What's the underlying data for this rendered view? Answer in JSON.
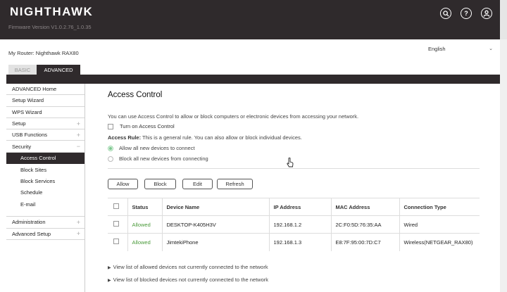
{
  "header": {
    "brand": "NIGHTHAWK",
    "firmware": "Firmware Version V1.0.2.76_1.0.35",
    "icons": [
      "search-icon",
      "help-icon",
      "user-icon"
    ]
  },
  "router": {
    "label": "My Router: Nighthawk RAX80"
  },
  "language": {
    "selected": "English"
  },
  "tabs": {
    "basic": "BASIC",
    "advanced": "ADVANCED"
  },
  "sidebar": {
    "items": [
      {
        "label": "ADVANCED Home",
        "pm": ""
      },
      {
        "label": "Setup Wizard",
        "pm": ""
      },
      {
        "label": "WPS Wizard",
        "pm": ""
      },
      {
        "label": "Setup",
        "pm": "+"
      },
      {
        "label": "USB Functions",
        "pm": "+"
      },
      {
        "label": "Security",
        "pm": "−"
      }
    ],
    "security_sub": [
      "Access Control",
      "Block Sites",
      "Block Services",
      "Schedule",
      "E-mail"
    ],
    "bottom_items": [
      {
        "label": "Administration",
        "pm": "+"
      },
      {
        "label": "Advanced Setup",
        "pm": "+"
      }
    ]
  },
  "main": {
    "title": "Access Control",
    "description": "You can use Access Control to allow or block computers or electronic devices from accessing your network.",
    "turn_on_label": "Turn on Access Control",
    "rule_prefix": "Access Rule:",
    "rule_text": " This is a general rule. You can also allow or block individual devices.",
    "radio_allow": "Allow all new devices to connect",
    "radio_block": "Block all new devices from connecting",
    "buttons": {
      "allow": "Allow",
      "block": "Block",
      "edit": "Edit",
      "refresh": "Refresh"
    },
    "table": {
      "headers": [
        "Status",
        "Device Name",
        "IP Address",
        "MAC Address",
        "Connection Type"
      ],
      "rows": [
        {
          "status": "Allowed",
          "device": "DESKTOP-K405H3V",
          "ip": "192.168.1.2",
          "mac": "2C:F0:5D:76:35:AA",
          "conn": "Wired"
        },
        {
          "status": "Allowed",
          "device": "JimtekiPhone",
          "ip": "192.168.1.3",
          "mac": "E8:7F:95:00:7D:C7",
          "conn": "Wireless(NETGEAR_RAX80)"
        }
      ]
    },
    "link_allowed": "View list of allowed devices not currently connected to the network",
    "link_blocked": "View list of blocked devices not currently connected to the network"
  },
  "colors": {
    "header_bg": "#2f2a2c",
    "allowed_green": "#4a9a3a",
    "radio_green": "#7cc78f"
  }
}
